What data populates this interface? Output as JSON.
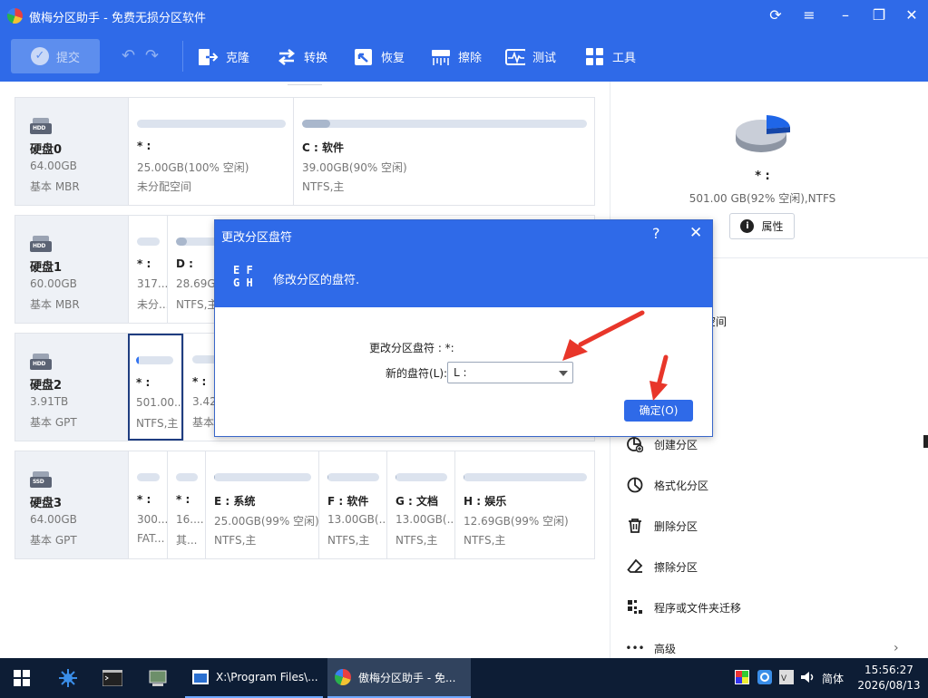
{
  "app": {
    "title": "傲梅分区助手 - 免费无损分区软件"
  },
  "toolbar": {
    "submit": "提交",
    "clone": "克隆",
    "convert": "转换",
    "recover": "恢复",
    "wipe": "擦除",
    "test": "测试",
    "tools": "工具"
  },
  "disks": [
    {
      "name": "硬盘0",
      "size": "64.00GB",
      "type": "基本 MBR",
      "icon": "HDD",
      "partitions": [
        {
          "name": "* :",
          "size": "25.00GB(100% 空闲)",
          "fs": "未分配空间",
          "used": 0
        },
        {
          "name": "C : 软件",
          "size": "39.00GB(90% 空闲)",
          "fs": "NTFS,主",
          "used": 0.1
        }
      ]
    },
    {
      "name": "硬盘1",
      "size": "60.00GB",
      "type": "基本 MBR",
      "icon": "HDD",
      "partitions": [
        {
          "name": "* :",
          "size": "317....",
          "fs": "未分...",
          "used": 0
        },
        {
          "name": "D :",
          "size": "28.69GB",
          "fs": "NTFS,主",
          "used": 0.1
        }
      ]
    },
    {
      "name": "硬盘2",
      "size": "3.91TB",
      "type": "基本 GPT",
      "icon": "HDD",
      "partitions": [
        {
          "name": "* :",
          "size": "501.00...",
          "fs": "NTFS,主",
          "used": 0.08
        },
        {
          "name": "* :",
          "size": "3.42",
          "fs": "基本分",
          "used": 0
        }
      ]
    },
    {
      "name": "硬盘3",
      "size": "64.00GB",
      "type": "基本 GPT",
      "icon": "SSD",
      "partitions": [
        {
          "name": "* :",
          "size": "300....",
          "fs": "FAT...",
          "used": 0
        },
        {
          "name": "* :",
          "size": "16....",
          "fs": "其...",
          "used": 0
        },
        {
          "name": "E : 系统",
          "size": "25.00GB(99% 空闲)",
          "fs": "NTFS,主",
          "used": 0.01
        },
        {
          "name": "F : 软件",
          "size": "13.00GB(...",
          "fs": "NTFS,主",
          "used": 0.01
        },
        {
          "name": "G : 文档",
          "size": "13.00GB(...",
          "fs": "NTFS,主",
          "used": 0.01
        },
        {
          "name": "H : 娱乐",
          "size": "12.69GB(99% 空闲)",
          "fs": "NTFS,主",
          "used": 0.01
        }
      ]
    }
  ],
  "panel": {
    "partition": "* :",
    "info": "501.00 GB(92% 空闲),NTFS",
    "properties": "属性",
    "ops": [
      "区",
      "盘空间",
      "创建分区",
      "格式化分区",
      "删除分区",
      "擦除分区",
      "程序或文件夹迁移",
      "高级"
    ]
  },
  "dialog": {
    "title": "更改分区盘符",
    "help": "?",
    "close": "✕",
    "letters": "EFGH",
    "desc": "修改分区的盘符.",
    "current_label": "更改分区盘符 : *:",
    "new_label": "新的盘符(L):",
    "new_value": "L :",
    "ok": "确定(O)"
  },
  "taskbar": {
    "app1": "X:\\Program Files\\...",
    "app2": "傲梅分区助手 - 免...",
    "ime": "简体",
    "time": "15:56:27",
    "date": "2026/08/13"
  },
  "colors": {
    "accent": "#2f6ae8",
    "arrow": "#e8362a"
  }
}
